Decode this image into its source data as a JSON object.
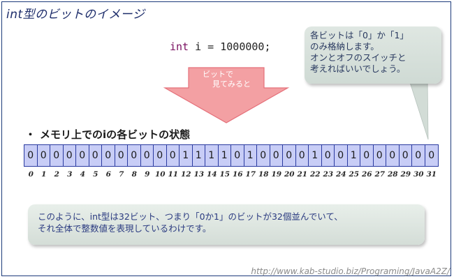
{
  "title": "int型のビットのイメージ",
  "code": {
    "keyword": "int",
    "rest": " i = 1000000;"
  },
  "bubble": {
    "lines": [
      "各ビットは「0」か「1」",
      "のみ格納します。",
      "オンとオフのスイッチと",
      "考えればいいでしょう。"
    ]
  },
  "arrow": {
    "line1": "ビットで",
    "line2": "見てみると",
    "fill_color": "#f3a0a3",
    "stroke_color": "#e5707a"
  },
  "bits_section": {
    "bullet": "・",
    "heading": "メモリ上でのiの各ビットの状態",
    "bits": [
      "0",
      "0",
      "0",
      "0",
      "0",
      "0",
      "0",
      "0",
      "0",
      "0",
      "0",
      "0",
      "1",
      "1",
      "1",
      "1",
      "0",
      "1",
      "0",
      "0",
      "0",
      "0",
      "1",
      "0",
      "0",
      "1",
      "0",
      "0",
      "0",
      "0",
      "0",
      "0"
    ],
    "indices": [
      "0",
      "1",
      "2",
      "3",
      "4",
      "5",
      "6",
      "7",
      "8",
      "9",
      "10",
      "11",
      "12",
      "13",
      "14",
      "15",
      "16",
      "17",
      "18",
      "19",
      "20",
      "21",
      "22",
      "23",
      "24",
      "25",
      "26",
      "27",
      "28",
      "29",
      "30",
      "31"
    ],
    "cell_color": "#c8cdf6",
    "border_color": "#2a3aa0"
  },
  "note": {
    "line1": "このように、int型は32ビット、つまり「0か1」のビットが32個並んでいて、",
    "line2": "それ全体で整数値を表現しているわけです。"
  },
  "footer": {
    "url": "http://www.kab-studio.biz/Programing/JavaA2Z/"
  }
}
